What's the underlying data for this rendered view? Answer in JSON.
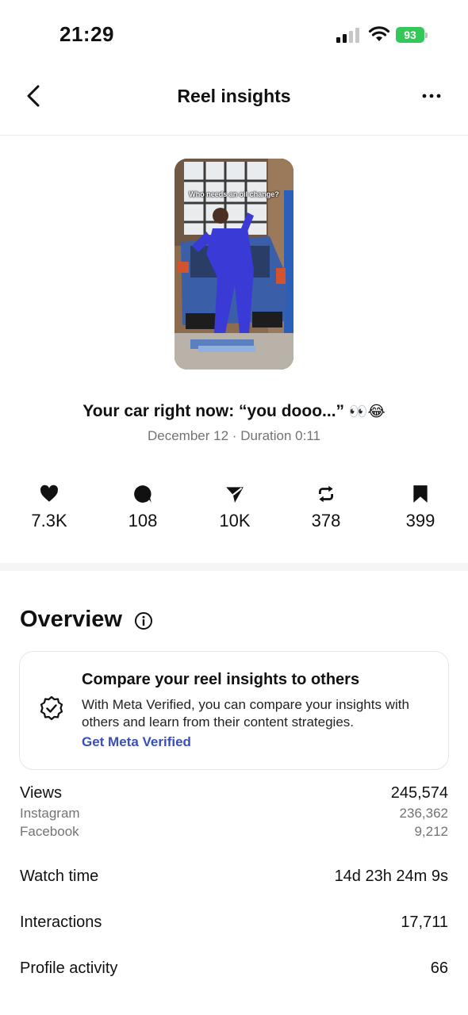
{
  "status_bar": {
    "time": "21:29",
    "battery": "93"
  },
  "nav": {
    "title": "Reel insights",
    "back_icon": "chevron-left-icon",
    "more_icon": "more-horizontal-icon"
  },
  "reel": {
    "overlay_text": "Who needs an oil change?",
    "caption": "Your car right now: “you dooo...”",
    "caption_emoji": "👀😂",
    "date": "December 12",
    "separator": "·",
    "duration": "Duration 0:11"
  },
  "stats": [
    {
      "icon": "heart-icon",
      "value": "7.3K"
    },
    {
      "icon": "comment-icon",
      "value": "108"
    },
    {
      "icon": "send-icon",
      "value": "10K"
    },
    {
      "icon": "repost-icon",
      "value": "378"
    },
    {
      "icon": "bookmark-icon",
      "value": "399"
    }
  ],
  "overview": {
    "title": "Overview",
    "info_icon": "info-icon"
  },
  "verified_card": {
    "title": "Compare your reel insights to others",
    "description": "With Meta Verified, you can compare your insights with others and learn from their content strategies.",
    "link": "Get Meta Verified",
    "icon": "verified-badge-icon"
  },
  "metrics": {
    "views": {
      "label": "Views",
      "value": "245,574"
    },
    "instagram": {
      "label": "Instagram",
      "value": "236,362"
    },
    "facebook": {
      "label": "Facebook",
      "value": "9,212"
    },
    "watch_time": {
      "label": "Watch time",
      "value": "14d 23h 24m 9s"
    },
    "interactions": {
      "label": "Interactions",
      "value": "17,711"
    },
    "profile_activity": {
      "label": "Profile activity",
      "value": "66"
    }
  },
  "colors": {
    "accent_link": "#3a4fb8",
    "battery": "#34c759",
    "muted_text": "#737373"
  }
}
